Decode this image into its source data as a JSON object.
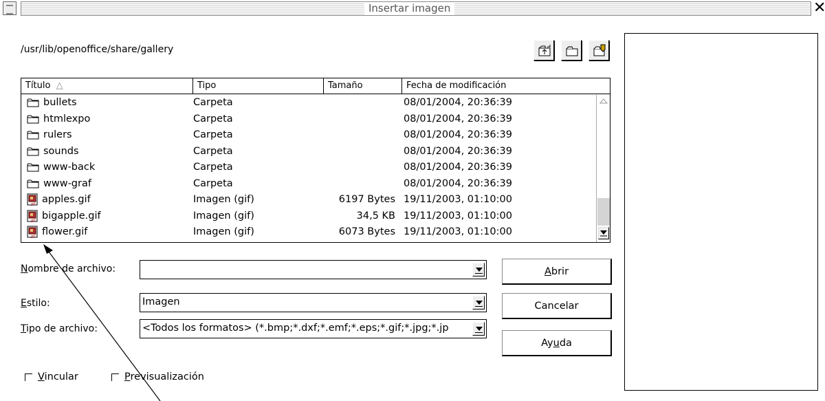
{
  "window": {
    "title": "Insertar imagen",
    "close_glyph": "✕"
  },
  "path": "/usr/lib/openoffice/share/gallery",
  "toolbar": {
    "icons": [
      "folder-up-icon",
      "new-folder-icon",
      "standard-dir-icon"
    ]
  },
  "list": {
    "columns": [
      "Título",
      "Tipo",
      "Tamaño",
      "Fecha de modificación"
    ],
    "sort_indicator": "△",
    "rows": [
      {
        "name": "bullets",
        "type": "Carpeta",
        "size": "",
        "date": "08/01/2004, 20:36:39",
        "icon": "folder-icon"
      },
      {
        "name": "htmlexpo",
        "type": "Carpeta",
        "size": "",
        "date": "08/01/2004, 20:36:39",
        "icon": "folder-icon"
      },
      {
        "name": "rulers",
        "type": "Carpeta",
        "size": "",
        "date": "08/01/2004, 20:36:39",
        "icon": "folder-icon"
      },
      {
        "name": "sounds",
        "type": "Carpeta",
        "size": "",
        "date": "08/01/2004, 20:36:39",
        "icon": "folder-icon"
      },
      {
        "name": "www-back",
        "type": "Carpeta",
        "size": "",
        "date": "08/01/2004, 20:36:39",
        "icon": "folder-icon"
      },
      {
        "name": "www-graf",
        "type": "Carpeta",
        "size": "",
        "date": "08/01/2004, 20:36:39",
        "icon": "folder-icon"
      },
      {
        "name": "apples.gif",
        "type": "Imagen (gif)",
        "size": "6197 Bytes",
        "date": "19/11/2003, 01:10:00",
        "icon": "gif-file-icon"
      },
      {
        "name": "bigapple.gif",
        "type": "Imagen (gif)",
        "size": "34,5 KB",
        "date": "19/11/2003, 01:10:00",
        "icon": "gif-file-icon"
      },
      {
        "name": "flower.gif",
        "type": "Imagen (gif)",
        "size": "6073 Bytes",
        "date": "19/11/2003, 01:10:00",
        "icon": "gif-file-icon"
      }
    ]
  },
  "form": {
    "filename_label_u": "N",
    "filename_label_rest": "ombre de archivo:",
    "filename_value": "",
    "style_label_u": "E",
    "style_label_rest": "stilo:",
    "style_value": "Imagen",
    "filetype_label_u": "T",
    "filetype_label_rest": "ipo de archivo:",
    "filetype_value": "<Todos los formatos> (*.bmp;*.dxf;*.emf;*.eps;*.gif;*.jpg;*.jp"
  },
  "buttons": {
    "open_u": "A",
    "open_rest": "brir",
    "cancel": "Cancelar",
    "help_pre": "Ay",
    "help_u": "u",
    "help_post": "da"
  },
  "options": {
    "link_u": "V",
    "link_rest": "incular",
    "preview_u": "P",
    "preview_rest": "revisualización"
  }
}
